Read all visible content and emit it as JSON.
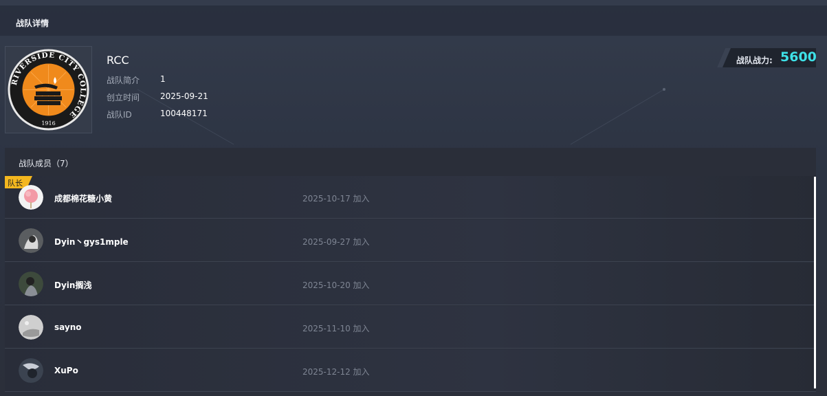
{
  "header": {
    "title": "战队详情"
  },
  "team": {
    "name": "RCC",
    "logo": {
      "ring_text": "RIVERSIDE CITY COLLEGE",
      "year": "1916",
      "colors": {
        "ring": "#1a1a1a",
        "inner": "#f08a1c",
        "rim": "#e8e8e8"
      }
    },
    "info": [
      {
        "label": "战队简介",
        "value": "1"
      },
      {
        "label": "创立时间",
        "value": "2025-09-21"
      },
      {
        "label": "战队ID",
        "value": "100448171"
      }
    ]
  },
  "power": {
    "label": "战队战力:",
    "value": "5600",
    "value_color": "#3ee1e8"
  },
  "members": {
    "title": "战队成员（7）",
    "captain_badge": "队长",
    "list": [
      {
        "name": "成都棉花糖小黄",
        "date": "2025-10-17 加入",
        "avatar_icon": "cotton-candy-avatar",
        "captain": true
      },
      {
        "name": "Dyin丶gys1mple",
        "date": "2025-09-27 加入",
        "avatar_icon": "user-photo-avatar",
        "captain": false
      },
      {
        "name": "Dyin搁浅",
        "date": "2025-10-20 加入",
        "avatar_icon": "user-photo-avatar",
        "captain": false
      },
      {
        "name": "sayno",
        "date": "2025-11-10 加入",
        "avatar_icon": "user-photo-avatar",
        "captain": false
      },
      {
        "name": "XuPo",
        "date": "2025-12-12 加入",
        "avatar_icon": "user-photo-avatar",
        "captain": false
      }
    ]
  }
}
